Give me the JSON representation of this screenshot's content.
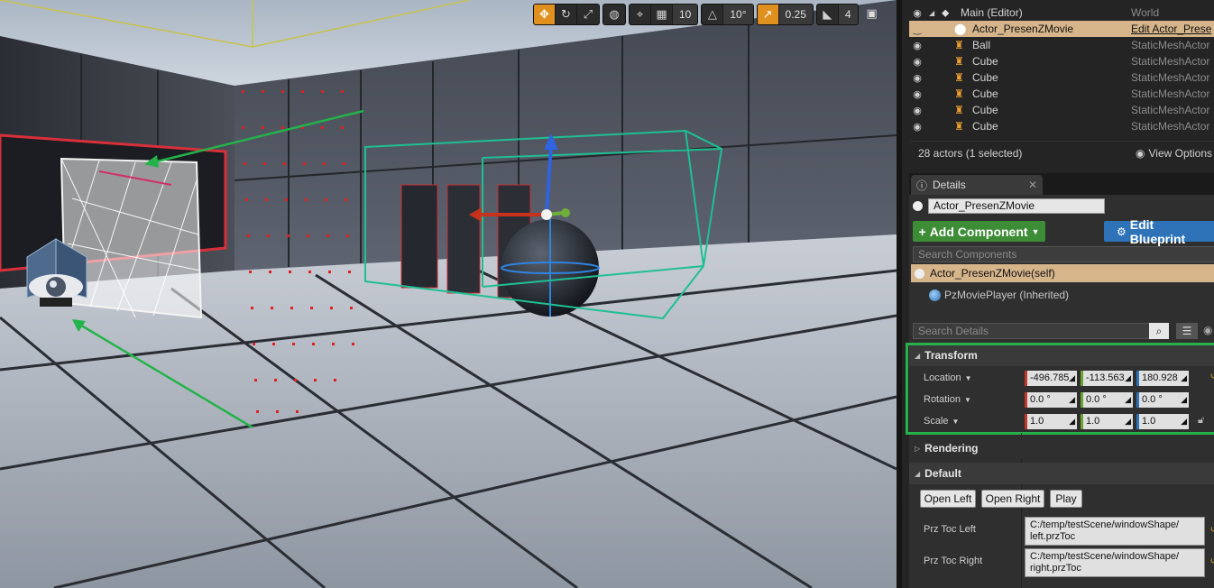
{
  "toolbar": {
    "grid_snap": "10",
    "rotation_snap": "10°",
    "scale_snap": "0.25",
    "camera_speed": "4"
  },
  "outliner": {
    "rows": [
      {
        "label": "Main (Editor)",
        "type": "World"
      },
      {
        "label": "Actor_PresenZMovie",
        "type": "Edit Actor_Prese"
      },
      {
        "label": "Ball",
        "type": "StaticMeshActor"
      },
      {
        "label": "Cube",
        "type": "StaticMeshActor"
      },
      {
        "label": "Cube",
        "type": "StaticMeshActor"
      },
      {
        "label": "Cube",
        "type": "StaticMeshActor"
      },
      {
        "label": "Cube",
        "type": "StaticMeshActor"
      },
      {
        "label": "Cube",
        "type": "StaticMeshActor"
      }
    ],
    "status": "28 actors (1 selected)",
    "view_options": "View Options"
  },
  "details": {
    "tab_label": "Details",
    "actor_name": "Actor_PresenZMovie",
    "add_component": "Add Component",
    "edit_blueprint": "Edit Blueprint",
    "search_components_placeholder": "Search Components",
    "component_self": "Actor_PresenZMovie(self)",
    "component_child": "PzMoviePlayer (Inherited)",
    "search_details_placeholder": "Search Details",
    "transform": {
      "header": "Transform",
      "location_label": "Location",
      "rotation_label": "Rotation",
      "scale_label": "Scale",
      "location": [
        "-496.785",
        "-113.563",
        "180.928"
      ],
      "rotation": [
        "0.0 °",
        "0.0 °",
        "0.0 °"
      ],
      "scale": [
        "1.0",
        "1.0",
        "1.0"
      ]
    },
    "rendering_header": "Rendering",
    "default_header": "Default",
    "buttons": {
      "open_left": "Open Left",
      "open_right": "Open Right",
      "play": "Play"
    },
    "prz_toc_left_label": "Prz Toc Left",
    "prz_toc_left_value_1": "C:/temp/testScene/windowShape/",
    "prz_toc_left_value_2": "left.przToc",
    "prz_toc_right_label": "Prz Toc Right",
    "prz_toc_right_value_1": "C:/temp/testScene/windowShape/",
    "prz_toc_right_value_2": "right.przToc"
  },
  "colors": {
    "selected_row": "#d6b58b",
    "add_component_green": "#3d8d37",
    "edit_blueprint_blue": "#2e73b8",
    "transform_highlight": "#27b14a",
    "toolbar_active": "#e0901f"
  }
}
